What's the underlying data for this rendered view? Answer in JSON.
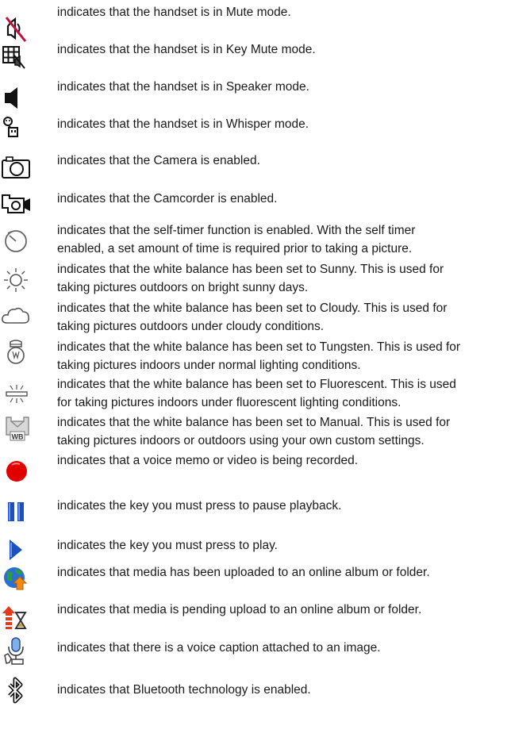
{
  "entries": [
    {
      "icon": "mute-icon",
      "text": [
        "indicates that the handset is in Mute mode."
      ]
    },
    {
      "icon": "key-mute-icon",
      "text": [
        "indicates that the handset is in Key Mute mode."
      ]
    },
    {
      "icon": "speaker-icon",
      "text": [
        "indicates that the handset is in Speaker mode."
      ]
    },
    {
      "icon": "whisper-icon",
      "text": [
        "indicates that the handset is in Whisper mode."
      ]
    },
    {
      "icon": "camera-icon",
      "text": [
        "indicates that the Camera is enabled."
      ]
    },
    {
      "icon": "camcorder-icon",
      "text": [
        "indicates that the Camcorder is enabled."
      ]
    },
    {
      "icon": "self-timer-icon",
      "text": [
        "indicates that the self-timer function is enabled. With the self timer",
        "enabled, a set amount of time is required prior to taking a picture."
      ]
    },
    {
      "icon": "sunny-icon",
      "text": [
        "indicates that the white balance has been set to Sunny. This is used for",
        "taking pictures outdoors on bright sunny days."
      ]
    },
    {
      "icon": "cloudy-icon",
      "text": [
        "indicates that the white balance has been set to Cloudy. This is used for",
        "taking pictures outdoors under cloudy conditions."
      ]
    },
    {
      "icon": "tungsten-icon",
      "text": [
        "indicates that the white balance has been set to Tungsten. This is used for",
        "taking pictures indoors under normal lighting conditions."
      ]
    },
    {
      "icon": "fluorescent-icon",
      "text": [
        "indicates that the white balance has been set to Fluorescent. This is used",
        "for taking pictures indoors under fluorescent lighting conditions."
      ]
    },
    {
      "icon": "manual-wb-icon",
      "text": [
        "indicates that the white balance has been set to Manual. This is used for",
        "taking pictures indoors or outdoors using your own custom settings."
      ]
    },
    {
      "icon": "record-icon",
      "text": [
        "indicates that a voice memo or video is being recorded."
      ]
    },
    {
      "icon": "pause-icon",
      "text": [
        "indicates the key you must press to pause playback."
      ]
    },
    {
      "icon": "play-icon",
      "text": [
        "indicates the key you must press to play."
      ]
    },
    {
      "icon": "uploaded-icon",
      "text": [
        "indicates that media has been uploaded to an online album or folder."
      ]
    },
    {
      "icon": "pending-upload-icon",
      "text": [
        "indicates that media is pending upload to an online album or folder."
      ]
    },
    {
      "icon": "voice-caption-icon",
      "text": [
        "indicates that there is a voice caption attached to an image."
      ]
    },
    {
      "icon": "bluetooth-icon",
      "text": [
        "indicates that Bluetooth technology is enabled."
      ]
    }
  ],
  "icon_labels": {
    "manual_wb": "WB"
  }
}
